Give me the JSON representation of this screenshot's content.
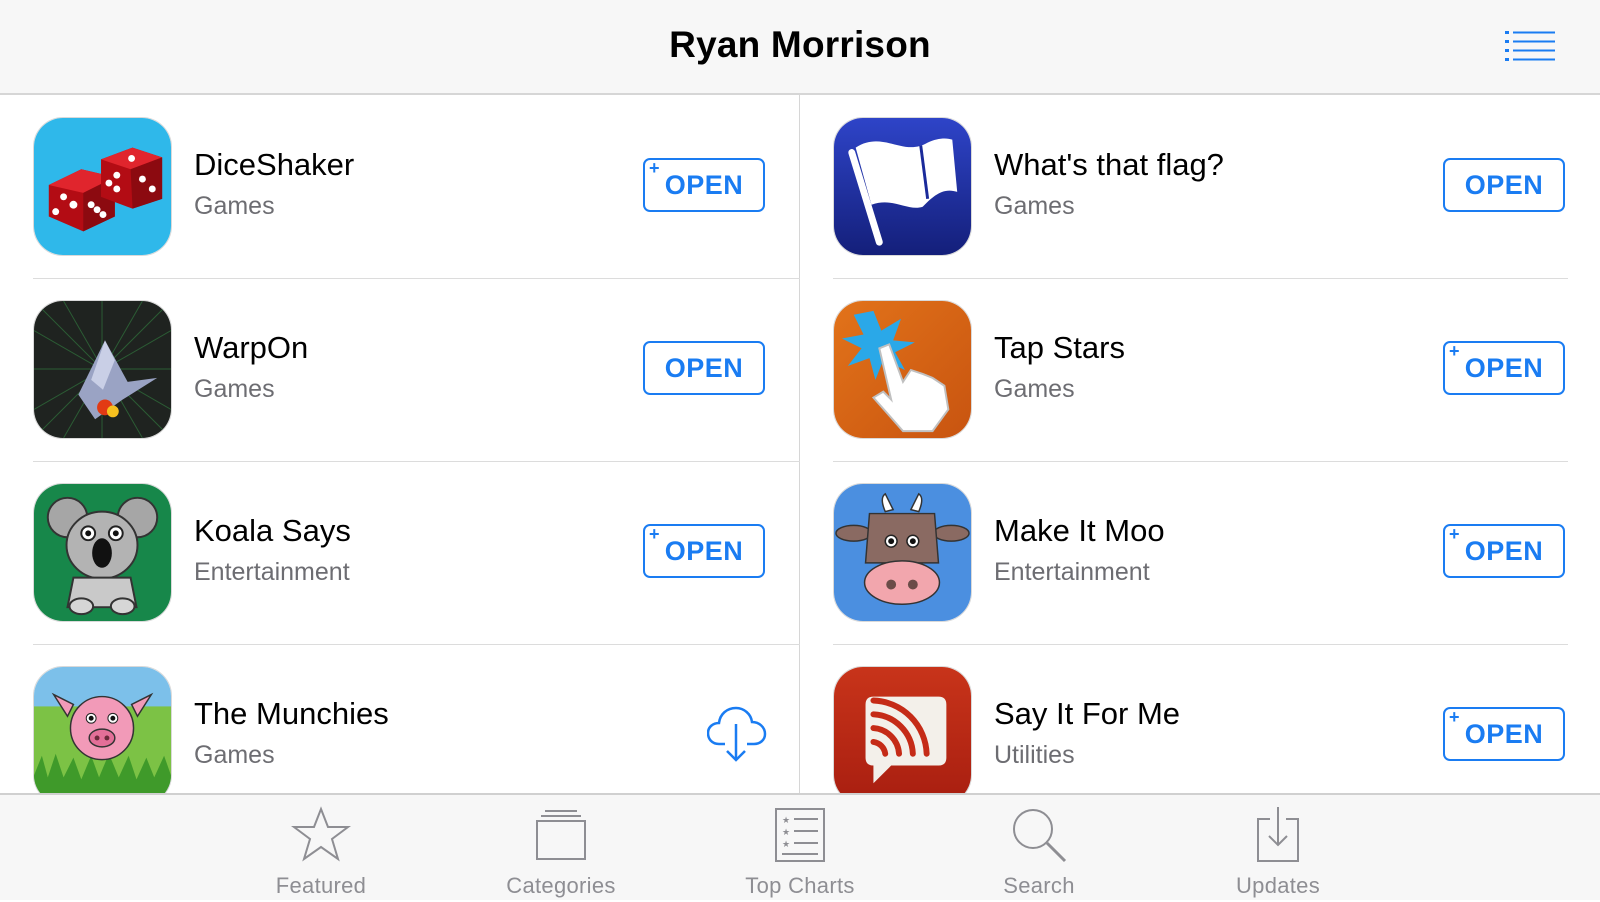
{
  "header": {
    "title": "Ryan Morrison"
  },
  "apps": [
    {
      "name": "DiceShaker",
      "category": "Games",
      "action": "OPEN",
      "plus": true
    },
    {
      "name": "What's that flag?",
      "category": "Games",
      "action": "OPEN",
      "plus": false
    },
    {
      "name": "WarpOn",
      "category": "Games",
      "action": "OPEN",
      "plus": false
    },
    {
      "name": "Tap Stars",
      "category": "Games",
      "action": "OPEN",
      "plus": true
    },
    {
      "name": "Koala Says",
      "category": "Entertainment",
      "action": "OPEN",
      "plus": true
    },
    {
      "name": "Make It Moo",
      "category": "Entertainment",
      "action": "OPEN",
      "plus": true
    },
    {
      "name": "The Munchies",
      "category": "Games",
      "action": "download",
      "plus": false
    },
    {
      "name": "Say It For Me",
      "category": "Utilities",
      "action": "OPEN",
      "plus": true
    }
  ],
  "tabs": [
    {
      "label": "Featured",
      "icon": "star-icon"
    },
    {
      "label": "Categories",
      "icon": "categories-icon"
    },
    {
      "label": "Top Charts",
      "icon": "top-charts-icon"
    },
    {
      "label": "Search",
      "icon": "search-icon"
    },
    {
      "label": "Updates",
      "icon": "updates-icon"
    }
  ],
  "colors": {
    "accent": "#1a7cf2",
    "tab_inactive": "#8e8e93",
    "secondary_text": "#6d6d72"
  }
}
